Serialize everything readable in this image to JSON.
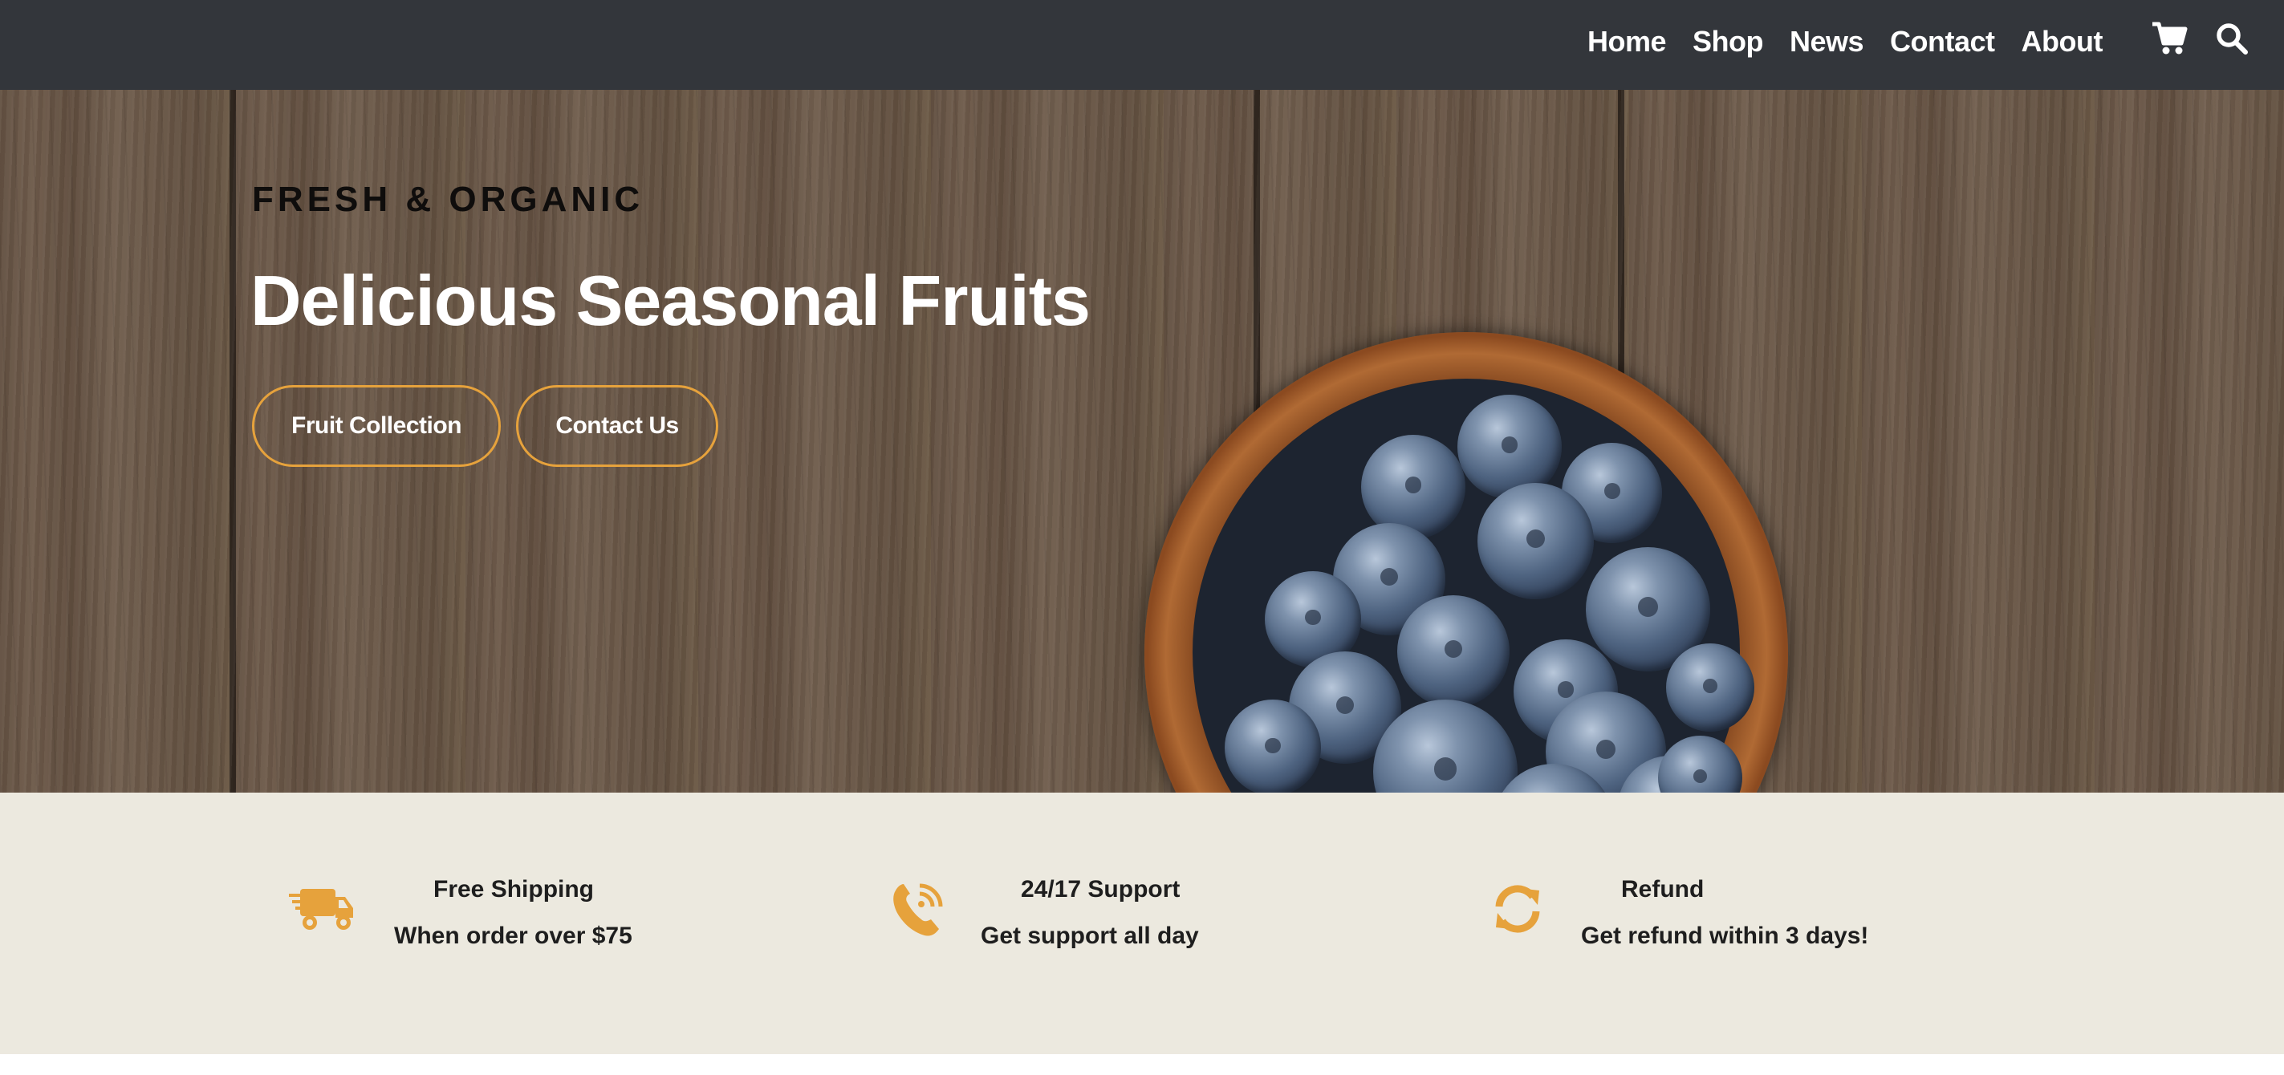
{
  "nav": {
    "items": [
      "Home",
      "Shop",
      "News",
      "Contact",
      "About"
    ],
    "icons": [
      "cart-icon",
      "search-icon"
    ]
  },
  "hero": {
    "subtitle": "FRESH & ORGANIC",
    "title": "Delicious Seasonal Fruits",
    "buttons": {
      "fruit_collection": "Fruit Collection",
      "contact_us": "Contact Us"
    }
  },
  "features": [
    {
      "icon": "truck-icon",
      "title": "Free Shipping",
      "text": "When order over $75"
    },
    {
      "icon": "phone-icon",
      "title": "24/17 Support",
      "text": "Get support all day"
    },
    {
      "icon": "refresh-icon",
      "title": "Refund",
      "text": "Get refund within 3 days!"
    }
  ],
  "colors": {
    "topbar": "#33363b",
    "accent": "#e6a23c",
    "features_bg": "#ece9df",
    "text_dark": "#1e1e1e"
  }
}
